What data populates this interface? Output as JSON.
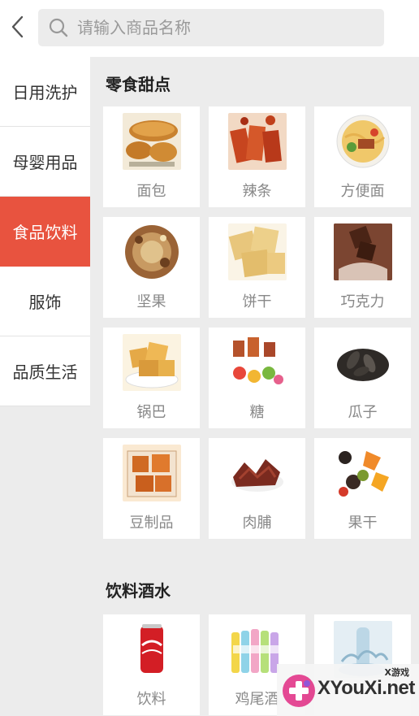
{
  "search": {
    "placeholder": "请输入商品名称"
  },
  "sidebar": {
    "items": [
      {
        "label": "日用洗护",
        "active": false
      },
      {
        "label": "母婴用品",
        "active": false
      },
      {
        "label": "食品饮料",
        "active": true
      },
      {
        "label": "服饰",
        "active": false
      },
      {
        "label": "品质生活",
        "active": false
      }
    ]
  },
  "sections": [
    {
      "title": "零食甜点",
      "products": [
        {
          "label": "面包",
          "icon": "bread-image"
        },
        {
          "label": "辣条",
          "icon": "spicy-strip-image"
        },
        {
          "label": "方便面",
          "icon": "instant-noodles-image"
        },
        {
          "label": "坚果",
          "icon": "nuts-image"
        },
        {
          "label": "饼干",
          "icon": "biscuit-image"
        },
        {
          "label": "巧克力",
          "icon": "chocolate-image"
        },
        {
          "label": "锅巴",
          "icon": "rice-crust-image"
        },
        {
          "label": "糖",
          "icon": "candy-image"
        },
        {
          "label": "瓜子",
          "icon": "sunflower-seeds-image"
        },
        {
          "label": "豆制品",
          "icon": "bean-product-image"
        },
        {
          "label": "肉脯",
          "icon": "jerky-image"
        },
        {
          "label": "果干",
          "icon": "dried-fruit-image"
        }
      ]
    },
    {
      "title": "饮料酒水",
      "products": [
        {
          "label": "饮料",
          "icon": "cola-can-image"
        },
        {
          "label": "鸡尾酒",
          "icon": "cocktail-bottles-image"
        },
        {
          "label": "",
          "icon": "water-bottle-image"
        }
      ]
    }
  ],
  "watermark": {
    "small": "X游戏",
    "big": "XYouXi.net"
  },
  "colors": {
    "accent": "#e8533f",
    "background": "#ececec"
  }
}
